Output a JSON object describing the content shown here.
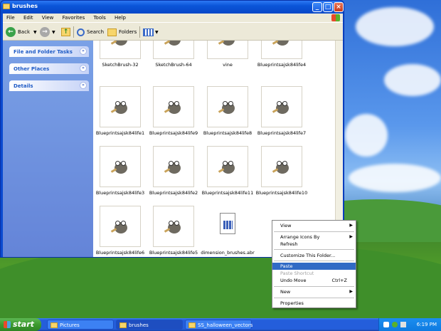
{
  "window": {
    "title": "brushes"
  },
  "menubar": [
    "File",
    "Edit",
    "View",
    "Favorites",
    "Tools",
    "Help"
  ],
  "toolbar": {
    "back": "Back",
    "search": "Search",
    "folders": "Folders"
  },
  "sidebar": {
    "panels": [
      {
        "label": "File and Folder Tasks"
      },
      {
        "label": "Other Places"
      },
      {
        "label": "Details"
      }
    ]
  },
  "files": [
    {
      "name": "SketchBrush-32",
      "type": "gimp"
    },
    {
      "name": "SketchBrush-64",
      "type": "gimp"
    },
    {
      "name": "vine",
      "type": "gimp"
    },
    {
      "name": "Blueprintsajsk84life4",
      "type": "gimp"
    },
    {
      "name": "Blueprintsajsk84life1",
      "type": "gimp"
    },
    {
      "name": "Blueprintsajsk84life9",
      "type": "gimp"
    },
    {
      "name": "Blueprintsajsk84life8",
      "type": "gimp"
    },
    {
      "name": "Blueprintsajsk84life7",
      "type": "gimp"
    },
    {
      "name": "Blueprintsajsk84life3",
      "type": "gimp"
    },
    {
      "name": "Blueprintsajsk84life2",
      "type": "gimp"
    },
    {
      "name": "Blueprintsajsk84life11",
      "type": "gimp"
    },
    {
      "name": "Blueprintsajsk84life10",
      "type": "gimp"
    },
    {
      "name": "Blueprintsajsk84life6",
      "type": "gimp"
    },
    {
      "name": "Blueprintsajsk84life5",
      "type": "gimp"
    },
    {
      "name": "dimension_brushes.abr",
      "type": "abr"
    }
  ],
  "context_menu": {
    "view": "View",
    "arrange": "Arrange Icons By",
    "refresh": "Refresh",
    "customize": "Customize This Folder...",
    "paste": "Paste",
    "paste_shortcut": "Paste Shortcut",
    "undo_move": "Undo Move",
    "undo_shortcut": "Ctrl+Z",
    "new": "New",
    "properties": "Properties"
  },
  "taskbar": {
    "start": "start",
    "tasks": [
      {
        "label": "Pictures"
      },
      {
        "label": "brushes"
      },
      {
        "label": "SS_halloween_vectors"
      }
    ],
    "clock": "6:19 PM"
  },
  "colors": {
    "accent": "#316ac5",
    "titlebar": "#0a55d8",
    "taskbar": "#245edb",
    "start": "#3c9a2e"
  }
}
